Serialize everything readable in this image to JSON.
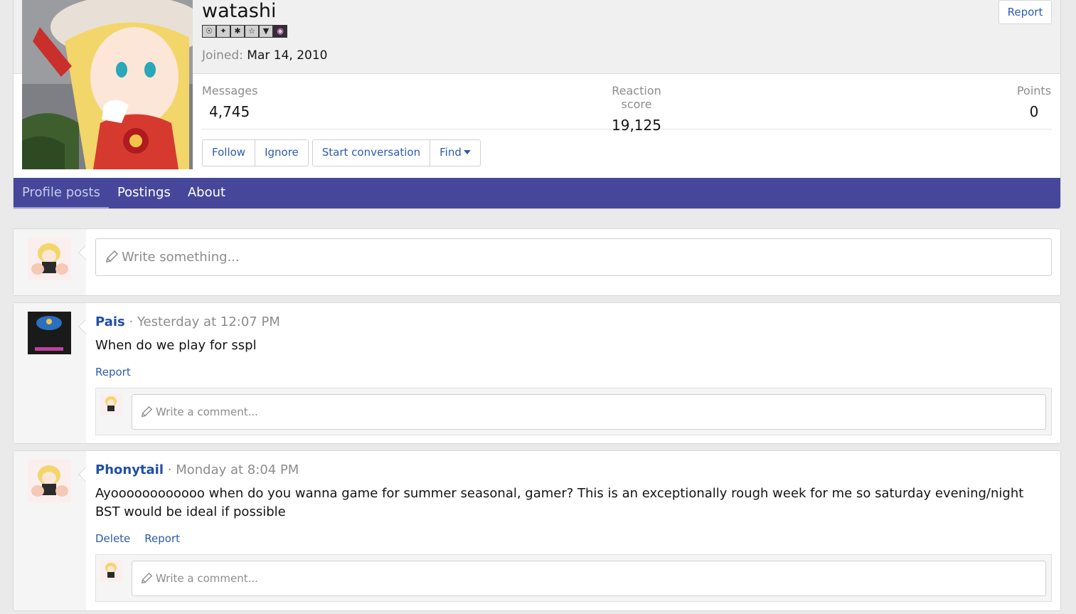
{
  "profile": {
    "username": "watashi",
    "joined_label": "Joined:",
    "joined_value": "Mar 14, 2010",
    "report_label": "Report",
    "badges": [
      "☉",
      "✦",
      "✱",
      "☆",
      "▼",
      "◉"
    ],
    "stats": [
      {
        "label": "Messages",
        "value": "4,745"
      },
      {
        "label": "Reaction score",
        "value": "19,125"
      },
      {
        "label": "Points",
        "value": "0"
      }
    ],
    "buttons": {
      "follow": "Follow",
      "ignore": "Ignore",
      "start_conversation": "Start conversation",
      "find": "Find"
    }
  },
  "tabs": [
    {
      "label": "Profile posts",
      "active": true
    },
    {
      "label": "Postings",
      "active": false
    },
    {
      "label": "About",
      "active": false
    }
  ],
  "composer": {
    "placeholder": "Write something..."
  },
  "posts": [
    {
      "author": "Pais",
      "separator": "·",
      "time": "Yesterday at 12:07 PM",
      "message": "When do we play for sspl",
      "actions": [
        "Report"
      ],
      "comment_placeholder": "Write a comment..."
    },
    {
      "author": "Phonytail",
      "separator": "·",
      "time": "Monday at 8:04 PM",
      "message": "Ayoooooooooooo when do you wanna game for summer seasonal, gamer? This is an exceptionally rough week for me so saturday evening/night BST would be ideal if possible",
      "actions": [
        "Delete",
        "Report"
      ],
      "comment_placeholder": "Write a comment..."
    }
  ],
  "colors": {
    "accent": "#46479a",
    "link": "#2c5bb1",
    "author": "#1f4fa8"
  }
}
